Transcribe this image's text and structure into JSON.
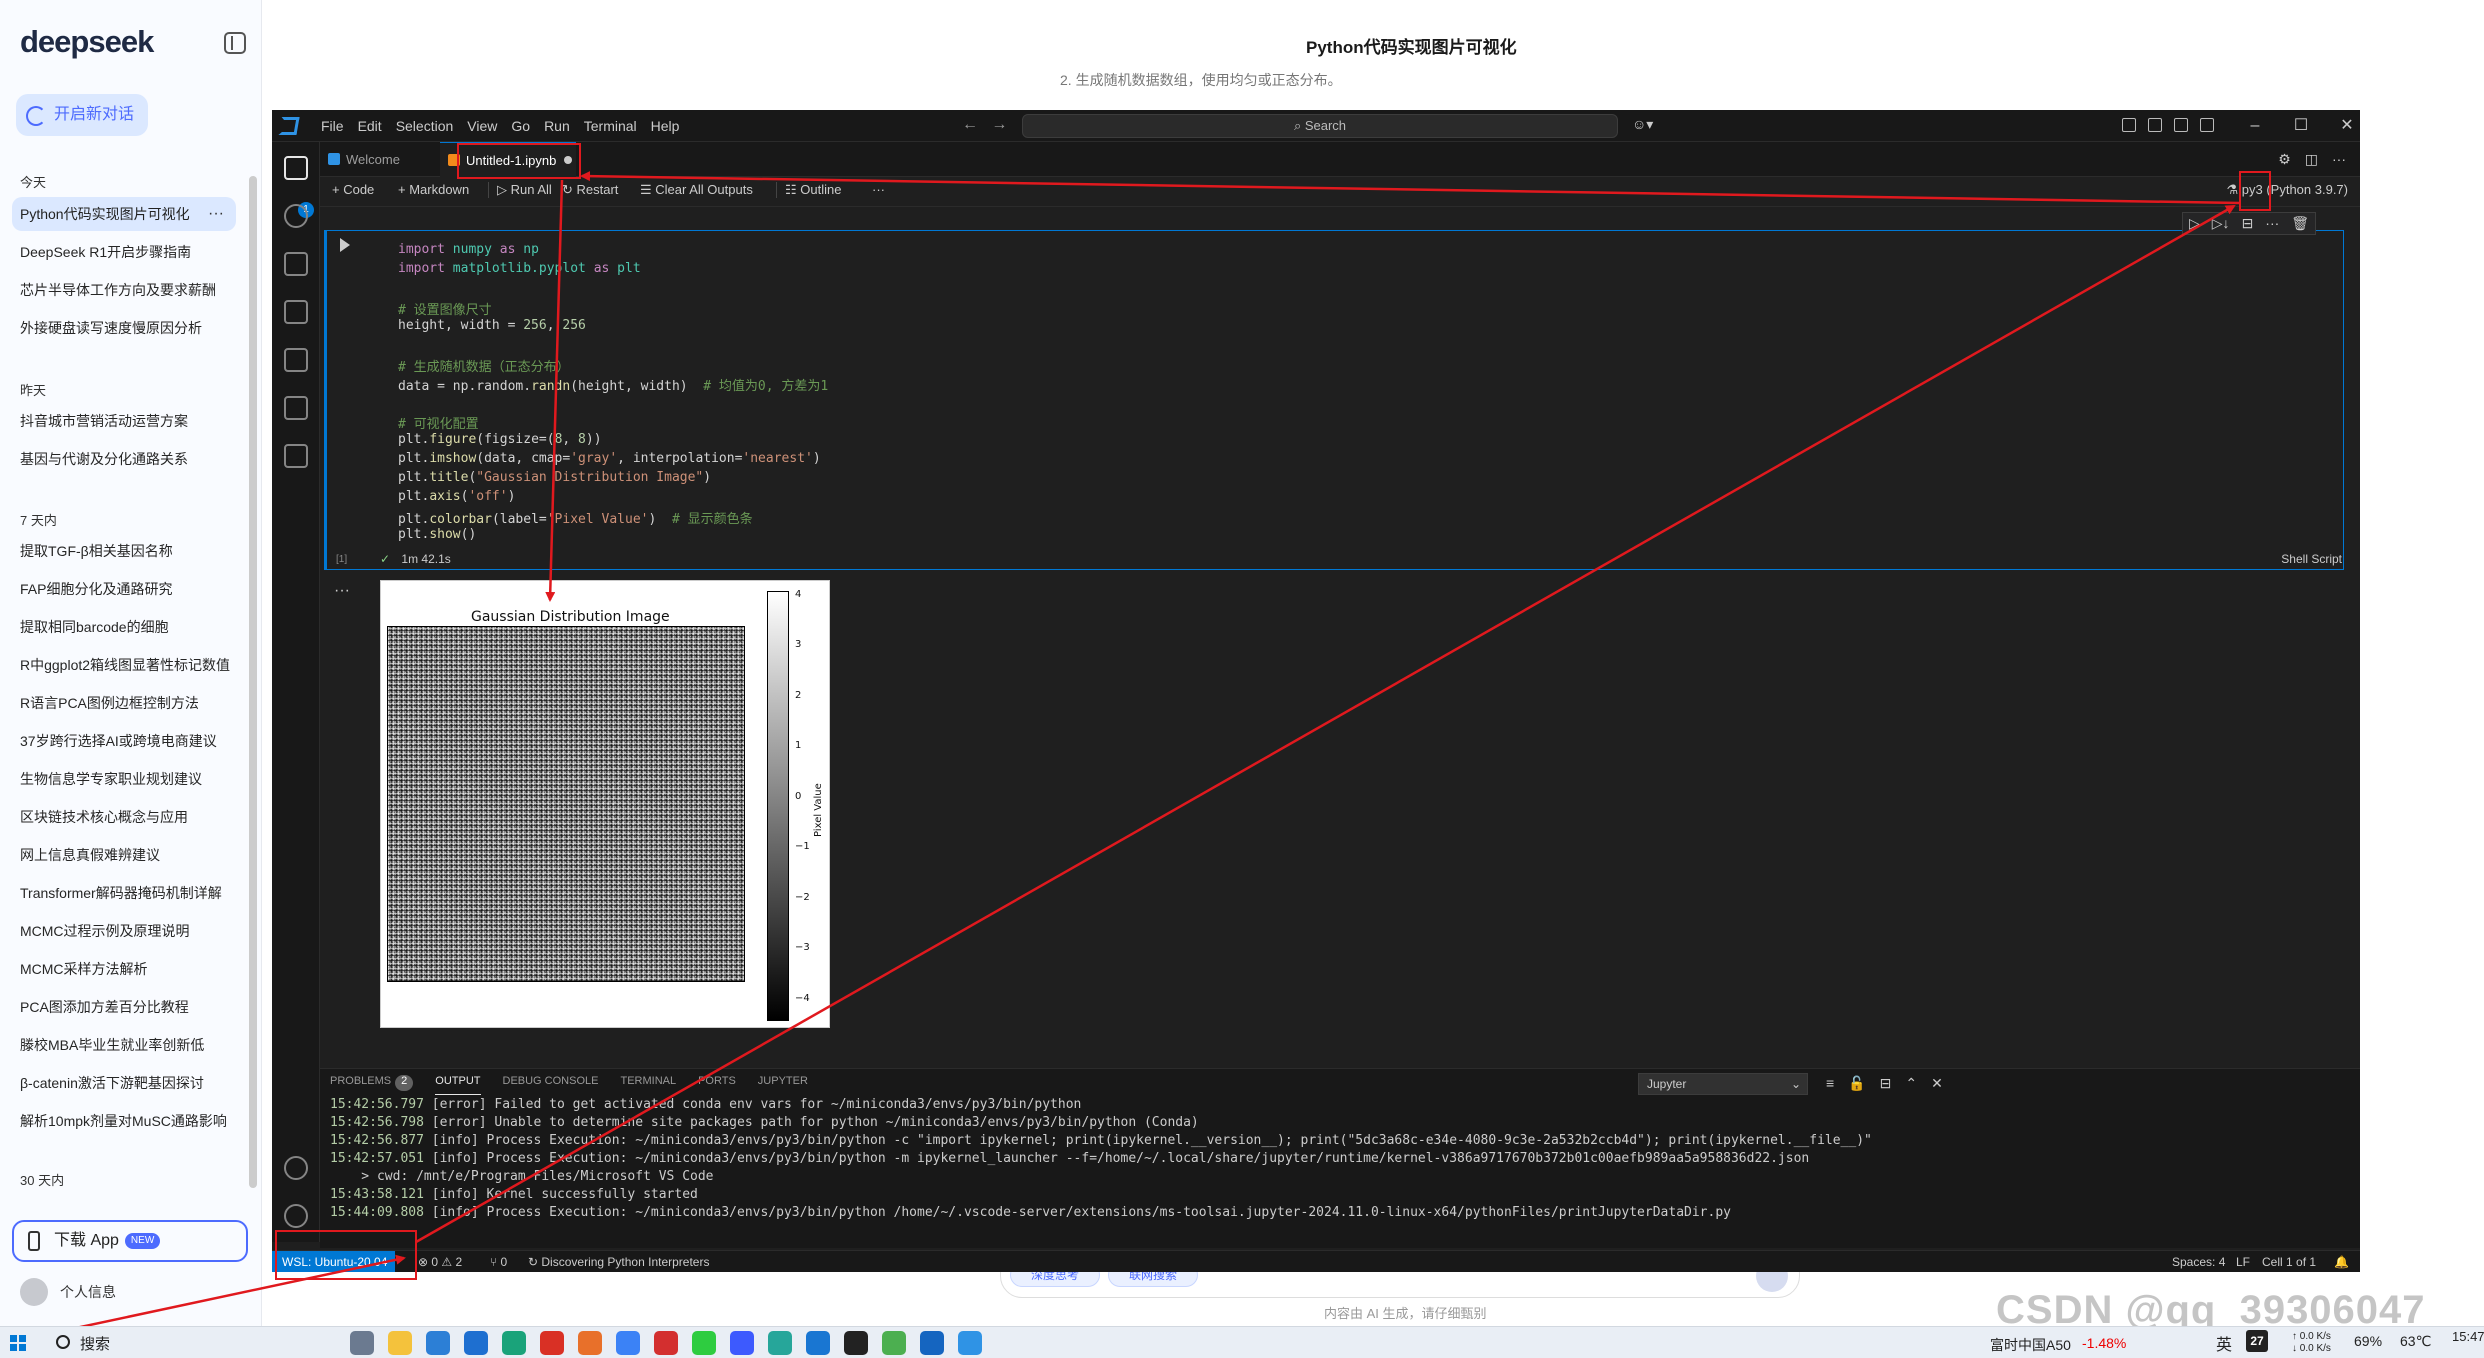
{
  "deepseek": {
    "logo": "deepseek",
    "new_chat": "开启新对话",
    "groups": {
      "today": "今天",
      "yesterday": "昨天",
      "week": "7 天内",
      "month": "30 天内"
    },
    "today_items": [
      "Python代码实现图片可视化",
      "DeepSeek R1开启步骤指南",
      "芯片半导体工作方向及要求薪酬",
      "外接硬盘读写速度慢原因分析"
    ],
    "yesterday_items": [
      "抖音城市营销活动运营方案",
      "基因与代谢及分化通路关系"
    ],
    "week_items": [
      "提取TGF-β相关基因名称",
      "FAP细胞分化及通路研究",
      "提取相同barcode的细胞",
      "R中ggplot2箱线图显著性标记数值",
      "R语言PCA图例边框控制方法",
      "37岁跨行选择AI或跨境电商建议",
      "生物信息学专家职业规划建议",
      "区块链技术核心概念与应用",
      "网上信息真假难辨建议",
      "Transformer解码器掩码机制详解",
      "MCMC过程示例及原理说明",
      "MCMC采样方法解析",
      "PCA图添加方差百分比教程",
      "滕校MBA毕业生就业率创新低",
      "β-catenin激活下游靶基因探讨",
      "解析10mpk剂量对MuSC通路影响"
    ],
    "more": "···",
    "download_app": "下载 App",
    "new_badge": "NEW",
    "user": "个人信息"
  },
  "chat": {
    "title": "Python代码实现图片可视化",
    "subtitle": "2. 生成随机数据数组，使用均匀或正态分布。",
    "chip_deep": "深度思考",
    "chip_search": "联网搜索",
    "footer": "内容由 AI 生成，请仔细甄别"
  },
  "vscode": {
    "menu": [
      "File",
      "Edit",
      "Selection",
      "View",
      "Go",
      "Run",
      "Terminal",
      "Help"
    ],
    "search": "Search",
    "tabs": {
      "welcome": "Welcome",
      "notebook": "Untitled-1.ipynb"
    },
    "toolbar": {
      "code": "+ Code",
      "markdown": "+ Markdown",
      "run_all": "Run All",
      "restart": "Restart",
      "clear": "Clear All Outputs",
      "outline": "Outline",
      "more": "···"
    },
    "kernel": "py3 (Python 3.9.7)",
    "code": {
      "l1": [
        "import",
        " numpy ",
        "as",
        " np"
      ],
      "l2": [
        "import",
        " matplotlib.pyplot ",
        "as",
        " plt"
      ],
      "l3": "# 设置图像尺寸",
      "l4": [
        "height, width = ",
        "256",
        ", ",
        "256"
      ],
      "l5": "# 生成随机数据（正态分布）",
      "l6": [
        "data = np.random.",
        "randn",
        "(height, width)  ",
        "# 均值为0, 方差为1"
      ],
      "l7": "# 可视化配置",
      "l8": [
        "plt.",
        "figure",
        "(figsize=(",
        "8",
        ", ",
        "8",
        "))"
      ],
      "l9": [
        "plt.",
        "imshow",
        "(data, cmap=",
        "'gray'",
        ", interpolation=",
        "'nearest'",
        ")"
      ],
      "l10": [
        "plt.",
        "title",
        "(",
        "\"Gaussian Distribution Image\"",
        ")"
      ],
      "l11": [
        "plt.",
        "axis",
        "(",
        "'off'",
        ")"
      ],
      "l12": [
        "plt.",
        "colorbar",
        "(label=",
        "'Pixel Value'",
        ")  ",
        "# 显示颜色条"
      ],
      "l13": [
        "plt.",
        "show",
        "()"
      ]
    },
    "exec_count": "[1]",
    "exec_time": "1m 42.1s",
    "language": "Shell Script",
    "figure": {
      "title": "Gaussian Distribution Image",
      "colorbar_label": "Pixel Value",
      "ticks": [
        "4",
        "3",
        "2",
        "1",
        "0",
        "−1",
        "−2",
        "−3",
        "−4"
      ]
    },
    "panel": {
      "tabs": [
        "PROBLEMS",
        "OUTPUT",
        "DEBUG CONSOLE",
        "TERMINAL",
        "PORTS",
        "JUPYTER"
      ],
      "problems_count": "2",
      "channel": "Jupyter",
      "logs": [
        {
          "ts": "15:42:56.797",
          "msg": " [error] Failed to get activated conda env vars for ~/miniconda3/envs/py3/bin/python"
        },
        {
          "ts": "15:42:56.798",
          "msg": " [error] Unable to determine site packages path for python ~/miniconda3/envs/py3/bin/python (Conda)"
        },
        {
          "ts": "15:42:56.877",
          "msg": " [info] Process Execution: ~/miniconda3/envs/py3/bin/python -c \"import ipykernel; print(ipykernel.__version__); print(\"5dc3a68c-e34e-4080-9c3e-2a532b2ccb4d\"); print(ipykernel.__file__)\""
        },
        {
          "ts": "15:42:57.051",
          "msg": " [info] Process Execution: ~/miniconda3/envs/py3/bin/python -m ipykernel_launcher --f=/home/~/.local/share/jupyter/runtime/kernel-v386a9717670b372b01c00aefb989aa5a958836d22.json"
        },
        {
          "ts": "",
          "msg": "    > cwd: /mnt/e/Program Files/Microsoft VS Code"
        },
        {
          "ts": "15:43:58.121",
          "msg": " [info] Kernel successfully started"
        },
        {
          "ts": "15:44:09.808",
          "msg": " [info] Process Execution: ~/miniconda3/envs/py3/bin/python /home/~/.vscode-server/extensions/ms-toolsai.jupyter-2024.11.0-linux-x64/pythonFiles/printJupyterDataDir.py"
        }
      ]
    },
    "status": {
      "remote": "WSL: Ubuntu-20.04",
      "errors": "⊗ 0 ⚠ 2",
      "ports": "⑂ 0",
      "discover": "Discovering Python Interpreters",
      "spaces": "Spaces: 4",
      "eol": "LF",
      "cell": "Cell 1 of 1"
    }
  },
  "taskbar": {
    "search": "搜索",
    "stock": "富时中国A50",
    "stock_change": "-1.48%",
    "ime": "英",
    "date_badge": "27",
    "net_up": "↑ 0.0 K/s",
    "net_down": "↓ 0.0 K/s",
    "battery": "69%",
    "temp": "63℃",
    "time": "15:47"
  },
  "watermark": "CSDN @qq_39306047",
  "colors": {
    "accent": "#4d6bfe",
    "vscode_blue": "#0078d4",
    "annotation": "#e0191e"
  }
}
